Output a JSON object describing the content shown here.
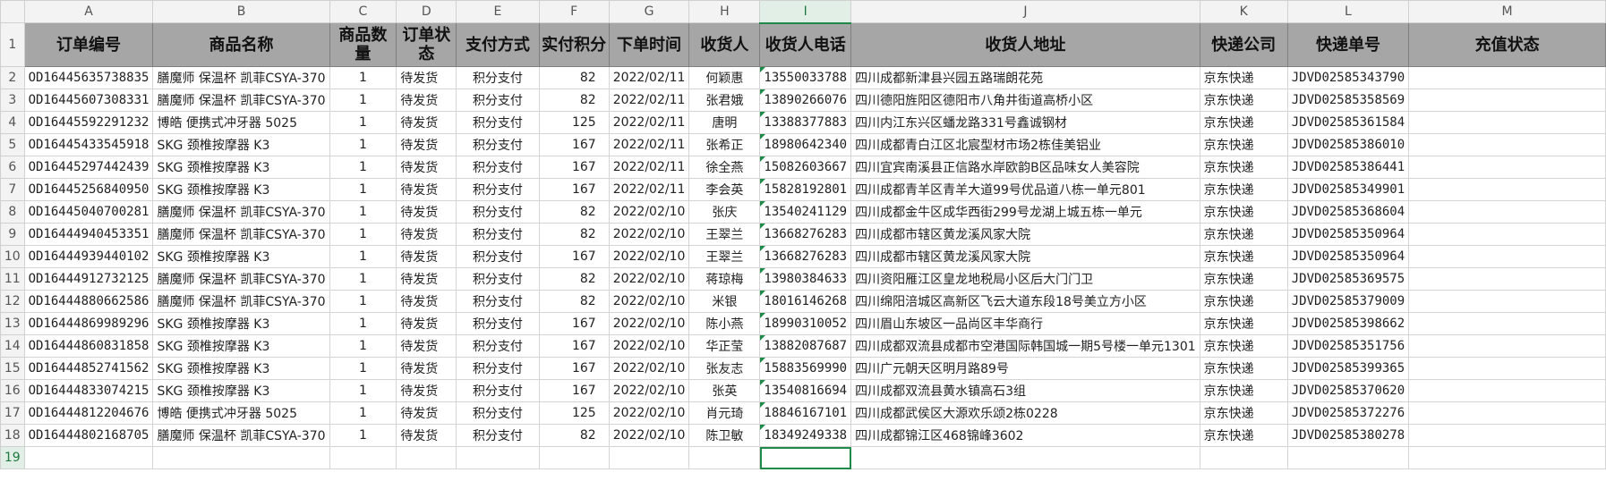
{
  "column_letters": [
    "A",
    "B",
    "C",
    "D",
    "E",
    "F",
    "G",
    "H",
    "I",
    "J",
    "K",
    "L",
    "M"
  ],
  "active_column": "I",
  "headers": [
    "订单编号",
    "商品名称",
    "商品数量",
    "订单状态",
    "支付方式",
    "实付积分",
    "下单时间",
    "收货人",
    "收货人电话",
    "收货人地址",
    "快递公司",
    "快递单号",
    "充值状态"
  ],
  "rows": [
    {
      "num": "2",
      "order_id": "OD16445635738835",
      "product": "膳魔师 保温杯 凯菲CSYA-370",
      "qty": "1",
      "status": "待发货",
      "pay": "积分支付",
      "points": "82",
      "date": "2022/02/11",
      "name": "何颖惠",
      "phone": "13550033788",
      "address": "四川成都新津县兴园五路瑞朗花苑",
      "courier": "京东快递",
      "tracking": "JDVD02585343790"
    },
    {
      "num": "3",
      "order_id": "OD16445607308331",
      "product": "膳魔师 保温杯 凯菲CSYA-370",
      "qty": "1",
      "status": "待发货",
      "pay": "积分支付",
      "points": "82",
      "date": "2022/02/11",
      "name": "张君娥",
      "phone": "13890266076",
      "address": "四川德阳旌阳区德阳市八角井街道高桥小区",
      "courier": "京东快递",
      "tracking": "JDVD02585358569"
    },
    {
      "num": "4",
      "order_id": "OD16445592291232",
      "product": "博皓 便携式冲牙器 5025",
      "qty": "1",
      "status": "待发货",
      "pay": "积分支付",
      "points": "125",
      "date": "2022/02/11",
      "name": "唐明",
      "phone": "13388377883",
      "address": "四川内江东兴区蟠龙路331号鑫诚钢材",
      "courier": "京东快递",
      "tracking": "JDVD02585361584"
    },
    {
      "num": "5",
      "order_id": "OD16445433545918",
      "product": "SKG 颈椎按摩器 K3",
      "qty": "1",
      "status": "待发货",
      "pay": "积分支付",
      "points": "167",
      "date": "2022/02/11",
      "name": "张希正",
      "phone": "18980642340",
      "address": "四川成都青白江区北宸型材市场2栋佳美铝业",
      "courier": "京东快递",
      "tracking": "JDVD02585386010"
    },
    {
      "num": "6",
      "order_id": "OD16445297442439",
      "product": "SKG 颈椎按摩器 K3",
      "qty": "1",
      "status": "待发货",
      "pay": "积分支付",
      "points": "167",
      "date": "2022/02/11",
      "name": "徐全燕",
      "phone": "15082603667",
      "address": "四川宜宾南溪县正信路水岸欧韵B区品味女人美容院",
      "courier": "京东快递",
      "tracking": "JDVD02585386441"
    },
    {
      "num": "7",
      "order_id": "OD16445256840950",
      "product": "SKG 颈椎按摩器 K3",
      "qty": "1",
      "status": "待发货",
      "pay": "积分支付",
      "points": "167",
      "date": "2022/02/11",
      "name": "李会英",
      "phone": "15828192801",
      "address": "四川成都青羊区青羊大道99号优品道八栋一单元801",
      "courier": "京东快递",
      "tracking": "JDVD02585349901"
    },
    {
      "num": "8",
      "order_id": "OD16445040700281",
      "product": "膳魔师 保温杯 凯菲CSYA-370",
      "qty": "1",
      "status": "待发货",
      "pay": "积分支付",
      "points": "82",
      "date": "2022/02/10",
      "name": "张庆",
      "phone": "13540241129",
      "address": "四川成都金牛区成华西街299号龙湖上城五栋一单元",
      "courier": "京东快递",
      "tracking": "JDVD02585368604"
    },
    {
      "num": "9",
      "order_id": "OD16444940453351",
      "product": "膳魔师 保温杯 凯菲CSYA-370",
      "qty": "1",
      "status": "待发货",
      "pay": "积分支付",
      "points": "82",
      "date": "2022/02/10",
      "name": "王翠兰",
      "phone": "13668276283",
      "address": "四川成都市辖区黄龙溪风家大院",
      "courier": "京东快递",
      "tracking": "JDVD02585350964"
    },
    {
      "num": "10",
      "order_id": "OD16444939440102",
      "product": "SKG 颈椎按摩器 K3",
      "qty": "1",
      "status": "待发货",
      "pay": "积分支付",
      "points": "167",
      "date": "2022/02/10",
      "name": "王翠兰",
      "phone": "13668276283",
      "address": "四川成都市辖区黄龙溪风家大院",
      "courier": "京东快递",
      "tracking": "JDVD02585350964"
    },
    {
      "num": "11",
      "order_id": "OD16444912732125",
      "product": "膳魔师 保温杯 凯菲CSYA-370",
      "qty": "1",
      "status": "待发货",
      "pay": "积分支付",
      "points": "82",
      "date": "2022/02/10",
      "name": "蒋琼梅",
      "phone": "13980384633",
      "address": "四川资阳雁江区皇龙地税局小区后大门门卫",
      "courier": "京东快递",
      "tracking": "JDVD02585369575"
    },
    {
      "num": "12",
      "order_id": "OD16444880662586",
      "product": "膳魔师 保温杯 凯菲CSYA-370",
      "qty": "1",
      "status": "待发货",
      "pay": "积分支付",
      "points": "82",
      "date": "2022/02/10",
      "name": "米银",
      "phone": "18016146268",
      "address": "四川绵阳涪城区高新区飞云大道东段18号美立方小区",
      "courier": "京东快递",
      "tracking": "JDVD02585379009"
    },
    {
      "num": "13",
      "order_id": "OD16444869989296",
      "product": "SKG 颈椎按摩器 K3",
      "qty": "1",
      "status": "待发货",
      "pay": "积分支付",
      "points": "167",
      "date": "2022/02/10",
      "name": "陈小燕",
      "phone": "18990310052",
      "address": "四川眉山东坡区一品尚区丰华商行",
      "courier": "京东快递",
      "tracking": "JDVD02585398662"
    },
    {
      "num": "14",
      "order_id": "OD16444860831858",
      "product": "SKG 颈椎按摩器 K3",
      "qty": "1",
      "status": "待发货",
      "pay": "积分支付",
      "points": "167",
      "date": "2022/02/10",
      "name": "华正莹",
      "phone": "13882087687",
      "address": "四川成都双流县成都市空港国际韩国城一期5号楼一单元1301",
      "courier": "京东快递",
      "tracking": "JDVD02585351756"
    },
    {
      "num": "15",
      "order_id": "OD16444852741562",
      "product": "SKG 颈椎按摩器 K3",
      "qty": "1",
      "status": "待发货",
      "pay": "积分支付",
      "points": "167",
      "date": "2022/02/10",
      "name": "张友志",
      "phone": "15883569990",
      "address": "四川广元朝天区明月路89号",
      "courier": "京东快递",
      "tracking": "JDVD02585399365"
    },
    {
      "num": "16",
      "order_id": "OD16444833074215",
      "product": "SKG 颈椎按摩器 K3",
      "qty": "1",
      "status": "待发货",
      "pay": "积分支付",
      "points": "167",
      "date": "2022/02/10",
      "name": "张英",
      "phone": "13540816694",
      "address": "四川成都双流县黄水镇高石3组",
      "courier": "京东快递",
      "tracking": "JDVD02585370620"
    },
    {
      "num": "17",
      "order_id": "OD16444812204676",
      "product": "博皓 便携式冲牙器 5025",
      "qty": "1",
      "status": "待发货",
      "pay": "积分支付",
      "points": "125",
      "date": "2022/02/10",
      "name": "肖元琦",
      "phone": "18846167101",
      "address": "四川成都武侯区大源欢乐颂2栋0228",
      "courier": "京东快递",
      "tracking": "JDVD02585372276"
    },
    {
      "num": "18",
      "order_id": "OD16444802168705",
      "product": "膳魔师 保温杯 凯菲CSYA-370",
      "qty": "1",
      "status": "待发货",
      "pay": "积分支付",
      "points": "82",
      "date": "2022/02/10",
      "name": "陈卫敏",
      "phone": "18349249338",
      "address": "四川成都锦江区468锦峰3602",
      "courier": "京东快递",
      "tracking": "JDVD02585380278"
    }
  ],
  "header_row_num": "1",
  "empty_row_num": "19",
  "colors": {
    "header_bg": "#a6a6a6",
    "active_accent": "#1e8a47",
    "grid_line": "#d4d4d4"
  }
}
